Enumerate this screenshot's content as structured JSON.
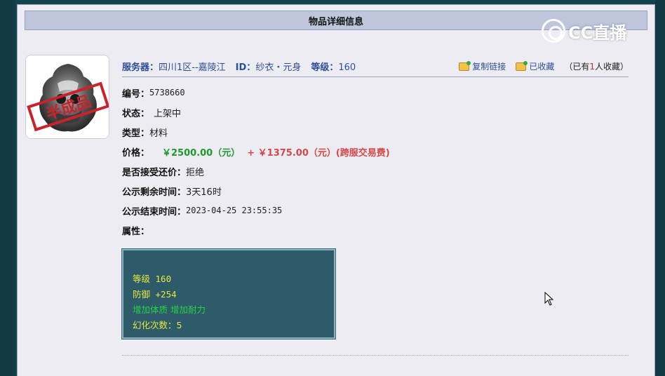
{
  "panel": {
    "title": "物品详细信息"
  },
  "watermark": {
    "text": "CC直播"
  },
  "item": {
    "stamp_text": "半成品",
    "server_label": "服务器：",
    "server_value": "四川1区--嘉陵江",
    "id_label": "ID：",
    "id_value": "纱衣・元身",
    "level_label": "等级：",
    "level_value": "160"
  },
  "actions": {
    "copy_link": "复制链接",
    "favorited": "已收藏",
    "fav_count_prefix": "（已有",
    "fav_count_num": "1",
    "fav_count_suffix": "人收藏）"
  },
  "details": {
    "serial_label": "编号：",
    "serial_value": "5738660",
    "status_label": "状态：",
    "status_value": "上架中",
    "type_label": "类型：",
    "type_value": "材料",
    "price_label": "价格：",
    "price_value": "￥2500.00（元）",
    "price_extra": "+ ￥1375.00（元）(跨服交易费)",
    "bargain_label": "是否接受还价：",
    "bargain_value": "拒绝",
    "remaining_label": "公示剩余时间：",
    "remaining_value": "3天16时",
    "end_label": "公示结束时间：",
    "end_value": "2023-04-25 23:55:35",
    "attr_label": "属性："
  },
  "attributes": {
    "level": "等级 160",
    "defense": "防御 +254",
    "bonus": "增加体质 增加耐力",
    "transform": "幻化次数：5"
  },
  "colors": {
    "page_bg": "#14424f",
    "panel_bg": "#ececf2",
    "header_bg": "#bfc6dc",
    "label_blue": "#2c4f9a",
    "price_green": "#1b9a2b",
    "price_red": "#d64848",
    "attr_box_bg": "#2d5b69",
    "attr_yellow": "#e8e840",
    "attr_green": "#28d048"
  },
  "icons": {
    "copy_link_icon": "copy-link-icon",
    "favorite_icon": "favorite-icon",
    "cursor": "mouse-pointer-icon"
  }
}
